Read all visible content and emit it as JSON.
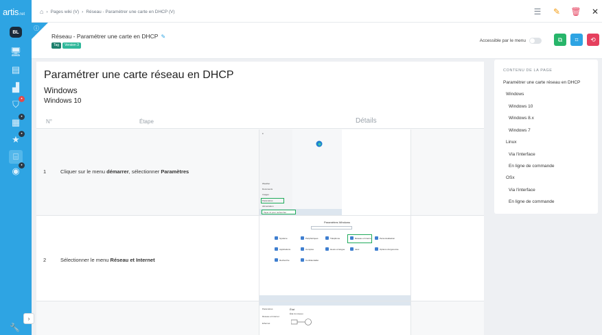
{
  "app": {
    "logo": "artis",
    "logo_suffix": ".net",
    "user_initials": "BL"
  },
  "breadcrumb": {
    "items": [
      "Pages wiki (V)",
      "Réseau - Paramétrer une carte en DHCP (V)"
    ]
  },
  "header": {
    "title": "Réseau - Paramétrer une carte en DHCP",
    "tags": [
      "Tag",
      "Version 3"
    ],
    "access_label": "Accessible par le menu"
  },
  "content": {
    "h1": "Paramétrer une carte réseau en DHCP",
    "h2": "Windows",
    "h3": "Windows 10",
    "table": {
      "headers": [
        "N°",
        "Étape",
        "Détails"
      ],
      "rows": [
        {
          "num": "1",
          "pre": "Cliquer sur le menu ",
          "bold1": "démarrer",
          "mid": ", sélectionner ",
          "bold2": "Paramètres"
        },
        {
          "num": "2",
          "pre": "Sélectionner le menu ",
          "bold1": "Réseau et Internet",
          "mid": "",
          "bold2": ""
        }
      ]
    }
  },
  "shot1": {
    "items": [
      "Weather",
      "Documents",
      "Images",
      "Paramètres",
      "Alimentation"
    ],
    "search": "Taper ici pour rechercher"
  },
  "shot2": {
    "title": "Paramètres Windows",
    "tiles": [
      "Système",
      "Périphériques",
      "Téléphone",
      "Réseau et Internet",
      "Personnalisation",
      "Applications",
      "Comptes",
      "Heure et langue",
      "Jeux",
      "Options d'ergonomie",
      "Recherche",
      "Confidentialité"
    ]
  },
  "shot3": {
    "lines": [
      "Paramètres",
      "État",
      "État du réseau",
      "Ethernet",
      "Réseau et Internet"
    ]
  },
  "toc": {
    "title": "CONTENU DE LA PAGE",
    "items": [
      {
        "label": "Paramétrer une carte réseau en DHCP",
        "level": 1
      },
      {
        "label": "Windows",
        "level": 2
      },
      {
        "label": "Windows 10",
        "level": 3
      },
      {
        "label": "Windows 8.x",
        "level": 3
      },
      {
        "label": "Windows 7",
        "level": 3
      },
      {
        "label": "Linux",
        "level": 2
      },
      {
        "label": "Via l'interface",
        "level": 3
      },
      {
        "label": "En ligne de commande",
        "level": 3
      },
      {
        "label": "OSx",
        "level": 2
      },
      {
        "label": "Via l'interface",
        "level": 3
      },
      {
        "label": "En ligne de commande",
        "level": 3
      }
    ]
  },
  "colors": {
    "brand": "#2ea4e3",
    "green": "#27b56a",
    "red": "#e5405e"
  }
}
